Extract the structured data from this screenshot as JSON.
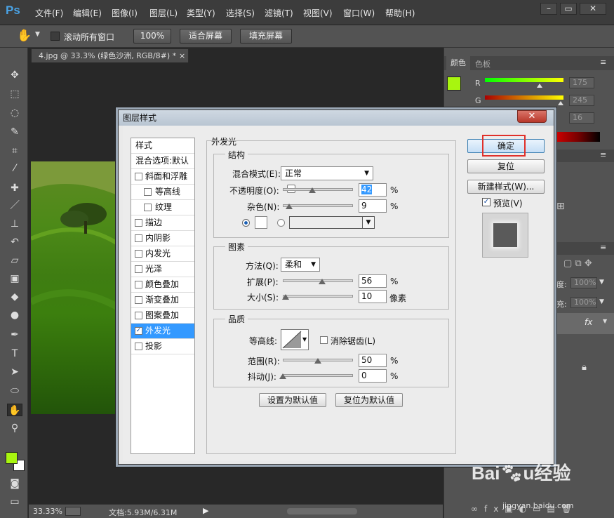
{
  "app": {
    "logo": "Ps"
  },
  "menu": [
    "文件(F)",
    "编辑(E)",
    "图像(I)",
    "图层(L)",
    "类型(Y)",
    "选择(S)",
    "滤镜(T)",
    "视图(V)",
    "窗口(W)",
    "帮助(H)"
  ],
  "window_controls": {
    "minimize": "–",
    "restore": "▭",
    "close": "✕"
  },
  "options": {
    "scroll_all": "滚动所有窗口",
    "zoom_100": "100%",
    "fit_screen": "适合屏幕",
    "fill_screen": "填充屏幕"
  },
  "document": {
    "tab_title": "4.jpg @ 33.3% (绿色沙洲, RGB/8#) *",
    "close": "×"
  },
  "status": {
    "zoom": "33.33%",
    "doc_size": "文档:5.93M/6.31M"
  },
  "right_panel": {
    "tabs": [
      "颜色",
      "色板"
    ],
    "channels": [
      {
        "label": "R",
        "value": "175"
      },
      {
        "label": "G",
        "value": "245"
      },
      {
        "label": "",
        "value": "16"
      }
    ],
    "percent_a": "100%",
    "percent_b": "100%",
    "fx": "fx",
    "opacity_label_suffix": "度:",
    "fill_label_suffix": "充:",
    "colors": {
      "foreground": "#a8f50f",
      "background": "#ffffff"
    }
  },
  "dialog": {
    "title": "图层样式",
    "close": "✕",
    "styles_header": "样式",
    "blend_default": "混合选项:默认",
    "style_items": [
      {
        "label": "斜面和浮雕",
        "checked": false,
        "indent": false
      },
      {
        "label": "等高线",
        "checked": false,
        "indent": true
      },
      {
        "label": "纹理",
        "checked": false,
        "indent": true
      },
      {
        "label": "描边",
        "checked": false,
        "indent": false
      },
      {
        "label": "内阴影",
        "checked": false,
        "indent": false
      },
      {
        "label": "内发光",
        "checked": false,
        "indent": false
      },
      {
        "label": "光泽",
        "checked": false,
        "indent": false
      },
      {
        "label": "颜色叠加",
        "checked": false,
        "indent": false
      },
      {
        "label": "渐变叠加",
        "checked": false,
        "indent": false
      },
      {
        "label": "图案叠加",
        "checked": false,
        "indent": false
      },
      {
        "label": "外发光",
        "checked": true,
        "indent": false,
        "selected": true
      },
      {
        "label": "投影",
        "checked": false,
        "indent": false
      }
    ],
    "section_title": "外发光",
    "structure": {
      "title": "结构",
      "blend_mode_label": "混合模式(E):",
      "blend_mode_value": "正常",
      "opacity_label": "不透明度(O):",
      "opacity_value": "42",
      "opacity_level": 42,
      "noise_label": "杂色(N):",
      "noise_value": "9",
      "noise_level": 9,
      "percent": "%"
    },
    "elements": {
      "title": "图素",
      "method_label": "方法(Q):",
      "method_value": "柔和",
      "spread_label": "扩展(P):",
      "spread_value": "56",
      "spread_level": 56,
      "size_label": "大小(S):",
      "size_value": "10",
      "size_level": 10,
      "size_unit": "像素",
      "percent": "%"
    },
    "quality": {
      "title": "品质",
      "contour_label": "等高线:",
      "antialias_label": "消除锯齿(L)",
      "range_label": "范围(R):",
      "range_value": "50",
      "range_level": 50,
      "jitter_label": "抖动(J):",
      "jitter_value": "0",
      "jitter_level": 0,
      "percent": "%"
    },
    "set_default": "设置为默认值",
    "reset_default": "复位为默认值",
    "ok": "确定",
    "reset": "复位",
    "new_style": "新建样式(W)...",
    "preview_label": "预览(V)"
  },
  "watermark": "Baidu经验 jingyan.baidu.com"
}
